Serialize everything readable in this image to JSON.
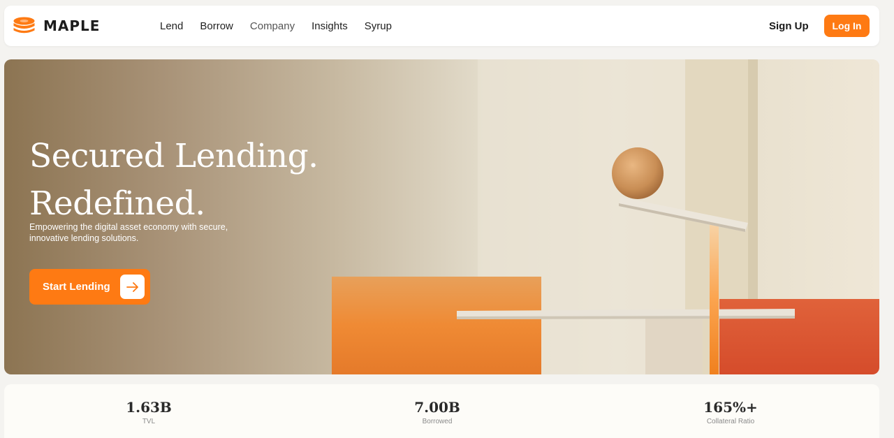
{
  "brand": {
    "name": "MAPLE",
    "accent": "#fe7a13"
  },
  "nav": {
    "links": [
      "Lend",
      "Borrow",
      "Company",
      "Insights",
      "Syrup"
    ],
    "signup_label": "Sign Up",
    "login_label": "Log In"
  },
  "hero": {
    "title_line1": "Secured Lending.",
    "title_line2": "Redefined.",
    "subtitle": "Empowering the digital asset economy with secure, innovative lending solutions.",
    "cta_label": "Start Lending",
    "cta_icon": "arrow-right-icon"
  },
  "stats": [
    {
      "value": "1.63B",
      "label": "TVL"
    },
    {
      "value": "7.00B",
      "label": "Borrowed"
    },
    {
      "value": "165%+",
      "label": "Collateral Ratio"
    }
  ]
}
